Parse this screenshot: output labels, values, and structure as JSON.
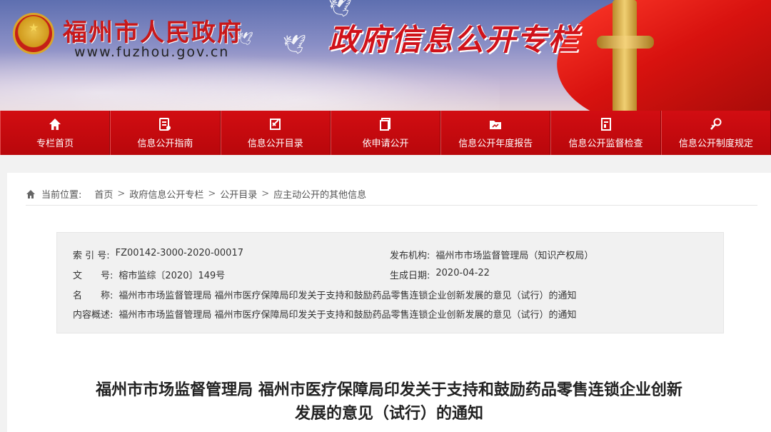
{
  "header": {
    "site_title": "福州市人民政府",
    "site_domain": "www.fuzhou.gov.cn",
    "column_title": "政府信息公开专栏"
  },
  "nav": {
    "items": [
      {
        "label": "专栏首页",
        "icon": "home-icon"
      },
      {
        "label": "信息公开指南",
        "icon": "guide-icon"
      },
      {
        "label": "信息公开目录",
        "icon": "catalog-icon"
      },
      {
        "label": "依申请公开",
        "icon": "application-icon"
      },
      {
        "label": "信息公开年度报告",
        "icon": "report-icon"
      },
      {
        "label": "信息公开监督检查",
        "icon": "inspection-icon"
      },
      {
        "label": "信息公开制度规定",
        "icon": "regulation-icon"
      }
    ]
  },
  "breadcrumb": {
    "label": "当前位置:",
    "items": [
      "首页",
      "政府信息公开专栏",
      "公开目录",
      "应主动公开的其他信息"
    ]
  },
  "meta": {
    "index_label": "索 引 号:",
    "index_value": "FZ00142-3000-2020-00017",
    "publisher_label": "发布机构:",
    "publisher_value": "福州市市场监督管理局（知识产权局）",
    "docno_label": "文　　号:",
    "docno_value": "榕市监综〔2020〕149号",
    "date_label": "生成日期:",
    "date_value": "2020-04-22",
    "name_label": "名　　称:",
    "name_value": "福州市市场监督管理局 福州市医疗保障局印发关于支持和鼓励药品零售连锁企业创新发展的意见（试行）的通知",
    "summary_label": "内容概述:",
    "summary_value": "福州市市场监督管理局 福州市医疗保障局印发关于支持和鼓励药品零售连锁企业创新发展的意见（试行）的通知"
  },
  "document": {
    "title_line1": "福州市市场监督管理局 福州市医疗保障局印发关于支持和鼓励药品零售连锁企业创新",
    "title_line2": "发展的意见（试行）的通知"
  },
  "colors": {
    "nav_red": "#c4080d",
    "title_red": "#c8181a",
    "meta_bg": "#f1f1f1"
  }
}
